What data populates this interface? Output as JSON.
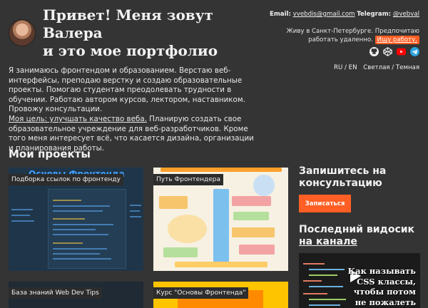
{
  "header": {
    "title_lines": [
      "Привет! Меня зовут",
      "Валера",
      "и это мое портфолио"
    ],
    "email_label": "Email:",
    "email": "vvebdis@gmail.com",
    "telegram_label": "Telegram:",
    "telegram": "@vebval",
    "location": "Живу в Санкт-Петербурге. Предпочитаю работать удаленно.",
    "remote_badge": "Ищу работу.",
    "socials": [
      "github-icon",
      "codepen-icon",
      "youtube-icon",
      "telegram-icon"
    ],
    "lang_ru": "RU",
    "lang_sep": "/",
    "lang_en": "EN",
    "theme_light": "Светлая",
    "theme_sep": "/",
    "theme_dark": "Темная"
  },
  "intro": {
    "text1": "Я занимаюсь фронтендом и образованием. Верстаю веб-интерфейсы, преподаю верстку и создаю образовательные проекты. Помогаю студентам преодолевать трудности в обучении. Работаю автором курсов, лектором, наставником. Провожу консультации.",
    "goal_link": "Моя цель: улучшать качество веба.",
    "text2": " Планирую создать свое образовательное учреждение для веб-разработчиков. Кроме того меня интересует всё, что касается дизайна, организации и планирования работы."
  },
  "projects": {
    "title": "Мои проекты",
    "items": [
      {
        "label": "Подборка ссылок по фронтенду",
        "thumb_text": "Основы Фронтенда"
      },
      {
        "label": "Путь Фронтендера"
      },
      {
        "label": "База знаний Web Dev Tips"
      },
      {
        "label": "Курс \"Основы Фронтенда\""
      }
    ]
  },
  "consult": {
    "title": "Запишитесь на консультацию",
    "button": "Записаться"
  },
  "video": {
    "title_prefix": "Последний видосик ",
    "title_link": "на канале",
    "thumb_text": "Как называть CSS классы, чтобы потом не пожалеть"
  },
  "colors": {
    "background": "#343434",
    "accent": "#ff5f24"
  }
}
